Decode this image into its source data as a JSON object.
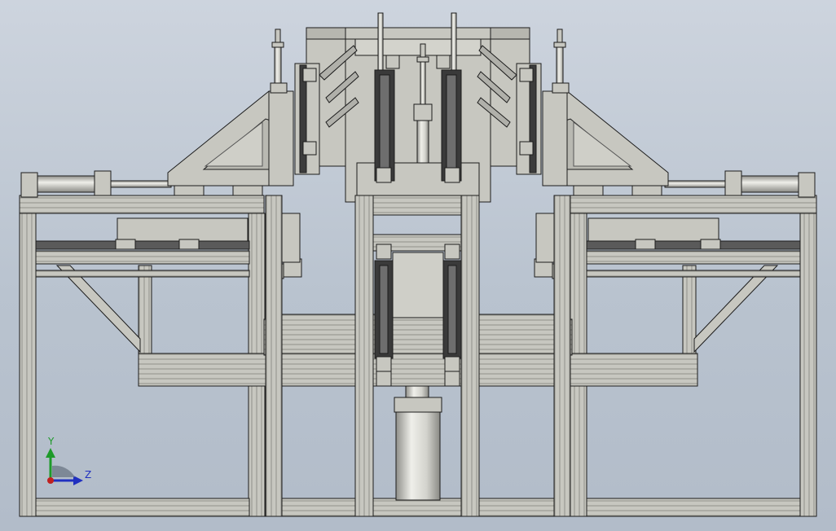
{
  "viewport": {
    "background_top": "#cdd4de",
    "background_bottom": "#b2bcc9",
    "model_fill": "#c7c7c0",
    "model_fill_dark": "#9e9e98",
    "edge_color": "#1c1c1c",
    "rail_color": "#5a5a5a"
  },
  "axis_triad": {
    "y_label": "Y",
    "z_label": "Z",
    "y_color": "#1e9a2a",
    "z_color": "#2030c0",
    "x_color": "#c02020"
  }
}
